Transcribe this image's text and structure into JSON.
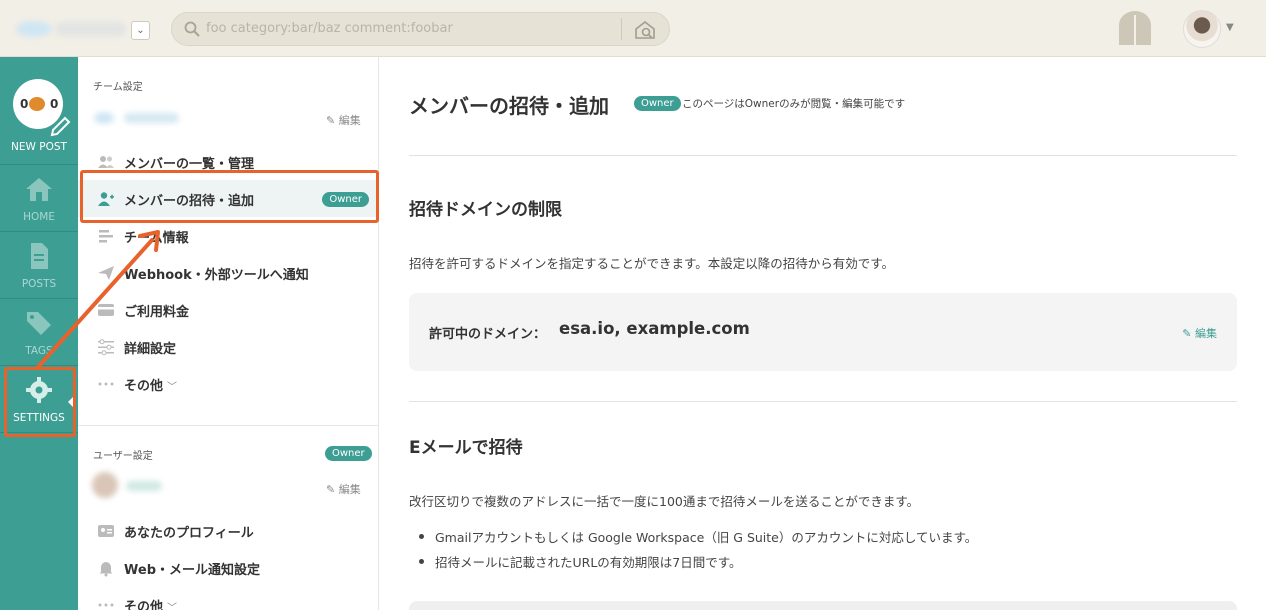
{
  "search": {
    "placeholder": "foo category:bar/baz comment:foobar"
  },
  "leftnav": {
    "new_post": "NEW POST",
    "home": "HOME",
    "posts": "POSTS",
    "tags": "TAGS",
    "settings": "SETTINGS"
  },
  "sidebar": {
    "team_section_title": "チーム設定",
    "team_edit": "編集",
    "team_items": [
      {
        "label": "メンバーの一覧・管理"
      },
      {
        "label": "メンバーの招待・追加",
        "badge": "Owner"
      },
      {
        "label": "チーム情報"
      },
      {
        "label": "Webhook・外部ツールへ通知"
      },
      {
        "label": "ご利用料金"
      },
      {
        "label": "詳細設定"
      },
      {
        "label": "その他"
      }
    ],
    "user_section_title": "ユーザー設定",
    "user_badge": "Owner",
    "user_edit": "編集",
    "user_items": [
      {
        "label": "あなたのプロフィール"
      },
      {
        "label": "Web・メール通知設定"
      },
      {
        "label": "その他"
      }
    ]
  },
  "main": {
    "title": "メンバーの招待・追加",
    "title_badge": "Owner",
    "title_note": "このページはOwnerのみが閲覧・編集可能です",
    "domain_section": {
      "heading": "招待ドメインの制限",
      "description": "招待を許可するドメインを指定することができます。本設定以降の招待から有効です。",
      "label": "許可中のドメイン：",
      "value": "esa.io, example.com",
      "edit": "編集"
    },
    "email_section": {
      "heading": "Eメールで招待",
      "description": "改行区切りで複数のアドレスに一括で一度に100通まで招待メールを送ることができます。",
      "bullets": [
        "Gmailアカウントもしくは Google Workspace（旧 G Suite）のアカウントに対応しています。",
        "招待メールに記載されたURLの有効期限は7日間です。"
      ]
    }
  },
  "colors": {
    "accent": "#3d9e94",
    "highlight": "#e8622c",
    "topbar": "#f2efe6"
  }
}
